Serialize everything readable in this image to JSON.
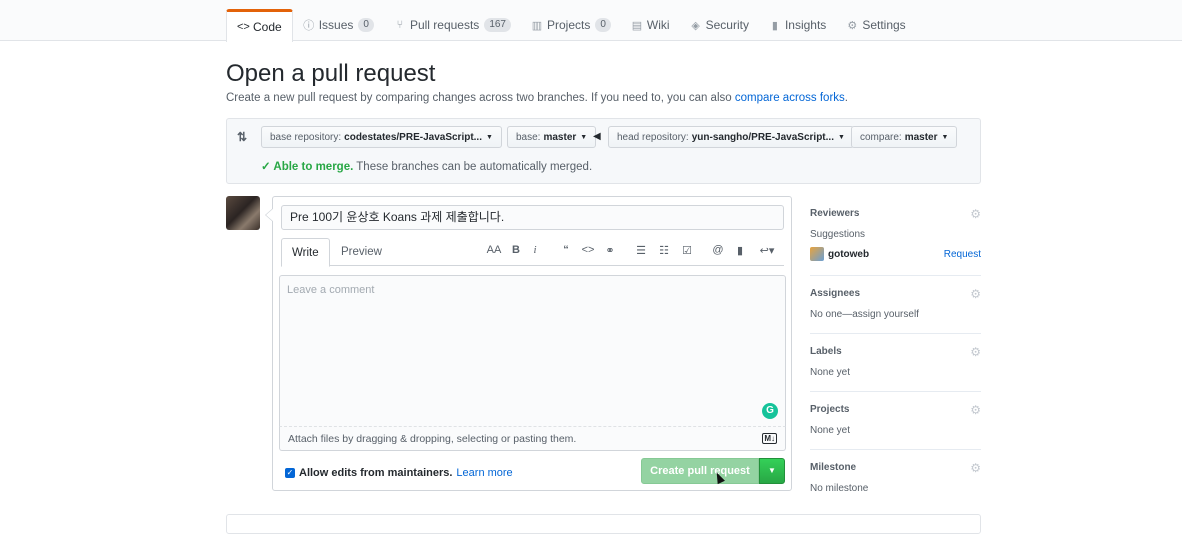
{
  "nav": {
    "tabs": [
      {
        "label": "Code",
        "icon": "<>",
        "counter": ""
      },
      {
        "label": "Issues",
        "icon": "ⓘ",
        "counter": "0"
      },
      {
        "label": "Pull requests",
        "icon": "⑂",
        "counter": "167"
      },
      {
        "label": "Projects",
        "icon": "▥",
        "counter": "0"
      },
      {
        "label": "Wiki",
        "icon": "▤",
        "counter": ""
      },
      {
        "label": "Security",
        "icon": "◈",
        "counter": ""
      },
      {
        "label": "Insights",
        "icon": "▮",
        "counter": ""
      },
      {
        "label": "Settings",
        "icon": "⚙",
        "counter": ""
      }
    ]
  },
  "page": {
    "title": "Open a pull request",
    "subtitle": "Create a new pull request by comparing changes across two branches. If you need to, you can also ",
    "subtitle_link": "compare across forks",
    "subtitle_end": "."
  },
  "range": {
    "base_repo_label": "base repository:",
    "base_repo_value": "codestates/PRE-JavaScript...",
    "base_label": "base:",
    "base_value": "master",
    "head_repo_label": "head repository:",
    "head_repo_value": "yun-sangho/PRE-JavaScript...",
    "compare_label": "compare:",
    "compare_value": "master",
    "merge_ok": "✓ Able to merge.",
    "merge_msg": " These branches can be automatically merged."
  },
  "form": {
    "title_value": "Pre 100기 윤상호 Koans 과제 제출합니다.",
    "tab_write": "Write",
    "tab_preview": "Preview",
    "placeholder": "Leave a comment",
    "attach_text": "Attach files by dragging & dropping, selecting or pasting them.",
    "md_badge": "M↓",
    "allow_label": "Allow edits from maintainers.",
    "learn_more": "Learn more",
    "create_button": "Create pull request"
  },
  "sidebar": {
    "reviewers": {
      "title": "Reviewers",
      "text": "Suggestions",
      "user": "gotoweb",
      "action": "Request"
    },
    "assignees": {
      "title": "Assignees",
      "text": "No one—assign yourself"
    },
    "labels": {
      "title": "Labels",
      "text": "None yet"
    },
    "projects": {
      "title": "Projects",
      "text": "None yet"
    },
    "milestone": {
      "title": "Milestone",
      "text": "No milestone"
    }
  },
  "colors": {
    "accent": "#0366d6",
    "success": "#28a745",
    "tab_active": "#e36209"
  }
}
